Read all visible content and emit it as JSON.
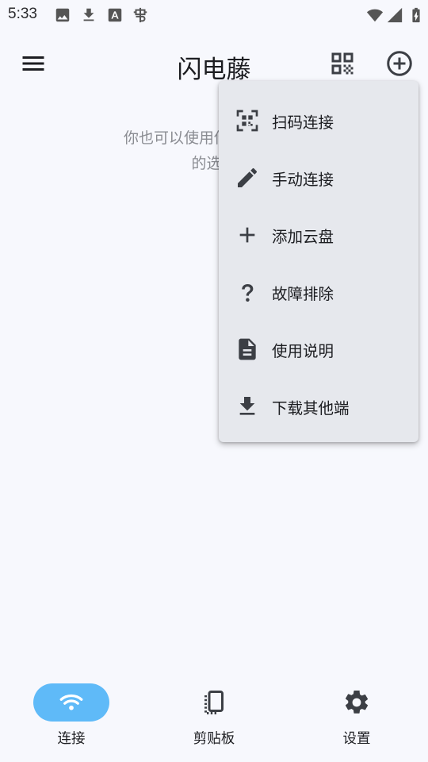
{
  "status_bar": {
    "time": "5:33",
    "left_icons": [
      "image-icon",
      "download-icon",
      "font-icon",
      "bug-icon"
    ],
    "right_icons": [
      "wifi-icon",
      "signal-icon",
      "battery-icon"
    ]
  },
  "app_bar": {
    "title": "闪电藤",
    "icons": [
      "menu-icon",
      "qr-code-icon",
      "add-circle-icon"
    ]
  },
  "main": {
    "hint_line1": "你也可以使用你的移动设备",
    "hint_line2": "的选择"
  },
  "menu": {
    "items": [
      {
        "label": "扫码连接",
        "icon": "qr-scan-icon"
      },
      {
        "label": "手动连接",
        "icon": "pencil-icon"
      },
      {
        "label": "添加云盘",
        "icon": "plus-icon"
      },
      {
        "label": "故障排除",
        "icon": "question-icon"
      },
      {
        "label": "使用说明",
        "icon": "document-icon"
      },
      {
        "label": "下载其他端",
        "icon": "download-icon"
      }
    ]
  },
  "bottom_nav": {
    "items": [
      {
        "label": "连接",
        "icon": "wifi-icon",
        "active": true
      },
      {
        "label": "剪贴板",
        "icon": "clipboard-icon",
        "active": false
      },
      {
        "label": "设置",
        "icon": "gear-icon",
        "active": false
      }
    ]
  },
  "colors": {
    "background": "#f7f8fd",
    "menu_background": "#e6e8ed",
    "active_pill": "#5fbaf8",
    "hint_text": "#8a8c92"
  }
}
